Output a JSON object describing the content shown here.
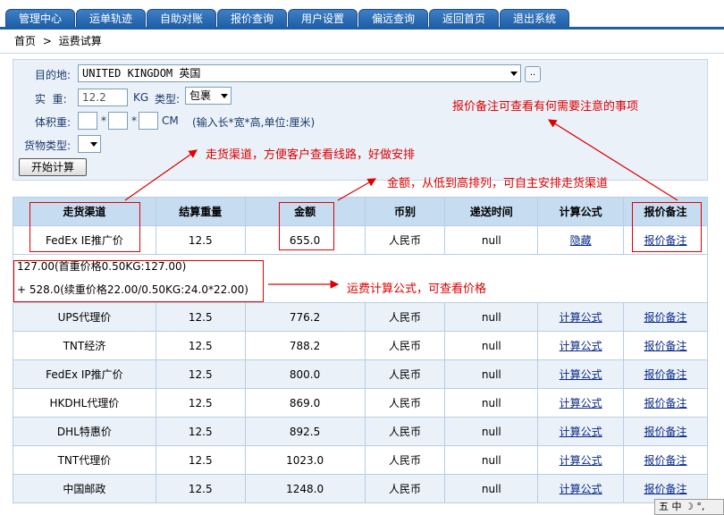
{
  "nav": {
    "tabs": [
      "管理中心",
      "运单轨迹",
      "自助对账",
      "报价查询",
      "用户设置",
      "偏远查询",
      "返回首页",
      "退出系统"
    ]
  },
  "breadcrumb": {
    "home": "首页",
    "separator": ">",
    "current": "运费试算"
  },
  "form": {
    "destination_label": "目的地:",
    "destination_value": "UNITED KINGDOM 英国",
    "destination_extra_button": "..",
    "weight_label": "实  重:",
    "weight_value": "12.2",
    "weight_unit": "KG",
    "type_label": "类型:",
    "type_value": "包裹",
    "volume_label": "体积重:",
    "volume_times": "*",
    "volume_unit": "CM",
    "volume_hint": "(输入长*宽*高,单位:厘米)",
    "goods_type_label": "货物类型:",
    "submit_label": "开始计算"
  },
  "table": {
    "headers": [
      "走货渠道",
      "结算重量",
      "金额",
      "币别",
      "递送时间",
      "计算公式",
      "报价备注"
    ],
    "first_row": {
      "channel": "FedEx IE推广价",
      "weight": "12.5",
      "amount": "655.0",
      "currency": "人民币",
      "time": "null",
      "formula_link": "隐藏",
      "remark_link": "报价备注"
    },
    "formula_lines": [
      "127.00(首重价格0.50KG:127.00)",
      "+ 528.0(续重价格22.00/0.50KG:24.0*22.00)"
    ],
    "rows": [
      {
        "channel": "UPS代理价",
        "weight": "12.5",
        "amount": "776.2",
        "currency": "人民币",
        "time": "null",
        "formula_link": "计算公式",
        "remark_link": "报价备注"
      },
      {
        "channel": "TNT经济",
        "weight": "12.5",
        "amount": "788.2",
        "currency": "人民币",
        "time": "null",
        "formula_link": "计算公式",
        "remark_link": "报价备注"
      },
      {
        "channel": "FedEx IP推广价",
        "weight": "12.5",
        "amount": "800.0",
        "currency": "人民币",
        "time": "null",
        "formula_link": "计算公式",
        "remark_link": "报价备注"
      },
      {
        "channel": "HKDHL代理价",
        "weight": "12.5",
        "amount": "869.0",
        "currency": "人民币",
        "time": "null",
        "formula_link": "计算公式",
        "remark_link": "报价备注"
      },
      {
        "channel": "DHL特惠价",
        "weight": "12.5",
        "amount": "892.5",
        "currency": "人民币",
        "time": "null",
        "formula_link": "计算公式",
        "remark_link": "报价备注"
      },
      {
        "channel": "TNT代理价",
        "weight": "12.5",
        "amount": "1023.0",
        "currency": "人民币",
        "time": "null",
        "formula_link": "计算公式",
        "remark_link": "报价备注"
      },
      {
        "channel": "中国邮政",
        "weight": "12.5",
        "amount": "1248.0",
        "currency": "人民币",
        "time": "null",
        "formula_link": "计算公式",
        "remark_link": "报价备注"
      }
    ]
  },
  "annotations": {
    "remark_note": "报价备注可查看有何需要注意的事项",
    "channel_note": "走货渠道，方便客户查看线路，好做安排",
    "amount_note": "金额，从低到高排列，可自主安排走货渠道",
    "formula_note": "运费计算公式，可查看价格"
  },
  "colors": {
    "annotation": "#dd0000",
    "tab": "#1f5fa8",
    "header_bg": "#c6dcf0",
    "row_alt": "#eaf1f9"
  },
  "ime": {
    "label": "五 中 ☽ °,"
  }
}
